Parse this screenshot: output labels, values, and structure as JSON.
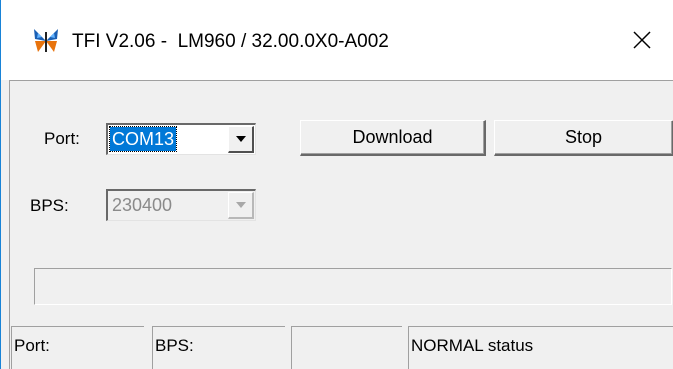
{
  "window": {
    "title": "TFI V2.06 -  LM960 / 32.00.0X0-A002",
    "app_icon": "butterfly-app-icon",
    "close_icon": "close-icon",
    "colors": {
      "border": "#1883d7",
      "selection": "#0078d7"
    }
  },
  "form": {
    "port_label": "Port:",
    "port_value": "COM13",
    "bps_label": "BPS:",
    "bps_value": "230400",
    "download_label": "Download",
    "stop_label": "Stop"
  },
  "progress": {
    "value": 0
  },
  "status": {
    "port": "Port:",
    "bps": "BPS:",
    "middle": "",
    "status_text": "NORMAL status"
  }
}
